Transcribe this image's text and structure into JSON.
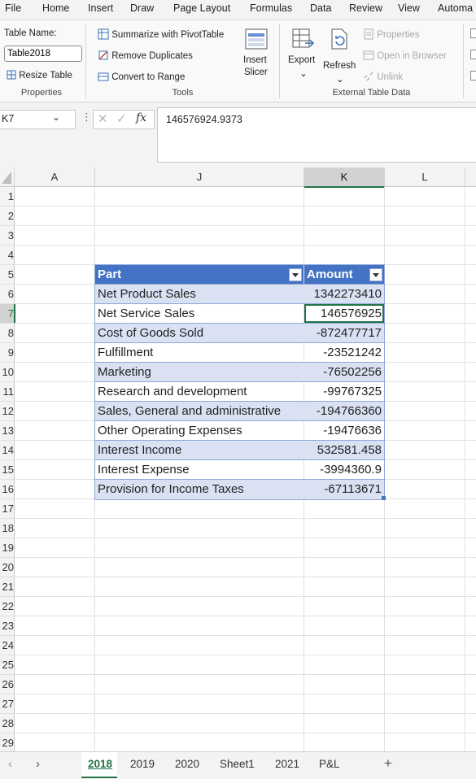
{
  "ribbon_tabs": [
    "File",
    "Home",
    "Insert",
    "Draw",
    "Page Layout",
    "Formulas",
    "Data",
    "Review",
    "View",
    "Automa"
  ],
  "ribbon": {
    "properties": {
      "table_name_label": "Table Name:",
      "table_name_value": "Table2018",
      "resize_table": "Resize Table",
      "group_label": "Properties"
    },
    "tools": {
      "summarize_pivot": "Summarize with PivotTable",
      "remove_duplicates": "Remove Duplicates",
      "convert_to_range": "Convert to Range",
      "insert_slicer_line1": "Insert",
      "insert_slicer_line2": "Slicer",
      "group_label": "Tools"
    },
    "external": {
      "export": "Export",
      "refresh": "Refresh",
      "properties": "Properties",
      "open_in_browser": "Open in Browser",
      "unlink": "Unlink",
      "group_label": "External Table Data"
    }
  },
  "formula_bar": {
    "name_box": "K7",
    "fx": "fx",
    "formula": "146576924.9373"
  },
  "columns": [
    "A",
    "J",
    "K",
    "L"
  ],
  "rows": [
    "1",
    "2",
    "3",
    "4",
    "5",
    "6",
    "7",
    "8",
    "9",
    "10",
    "11",
    "12",
    "13",
    "14",
    "15",
    "16",
    "17",
    "18",
    "19",
    "20",
    "21",
    "22",
    "23",
    "24",
    "25",
    "26",
    "27",
    "28",
    "29"
  ],
  "table": {
    "headers": [
      "Part",
      "Amount"
    ],
    "rows": [
      [
        "Net Product Sales",
        "1342273410"
      ],
      [
        "Net Service Sales",
        "146576925"
      ],
      [
        "Cost of Goods Sold",
        "-872477717"
      ],
      [
        "Fulfillment",
        "-23521242"
      ],
      [
        "Marketing",
        "-76502256"
      ],
      [
        "Research and development",
        "-99767325"
      ],
      [
        "Sales, General and administrative",
        "-194766360"
      ],
      [
        "Other Operating Expenses",
        "-19476636"
      ],
      [
        "Interest Income",
        "532581.458"
      ],
      [
        "Interest Expense",
        "-3994360.9"
      ],
      [
        "Provision for Income Taxes",
        "-67113671"
      ]
    ]
  },
  "sheet_tabs": [
    "2018",
    "2019",
    "2020",
    "Sheet1",
    "2021",
    "P&L"
  ],
  "active_sheet": "2018",
  "colors": {
    "header_blue": "#4472c4",
    "band_blue": "#d9e1f2",
    "active_green": "#217346"
  }
}
